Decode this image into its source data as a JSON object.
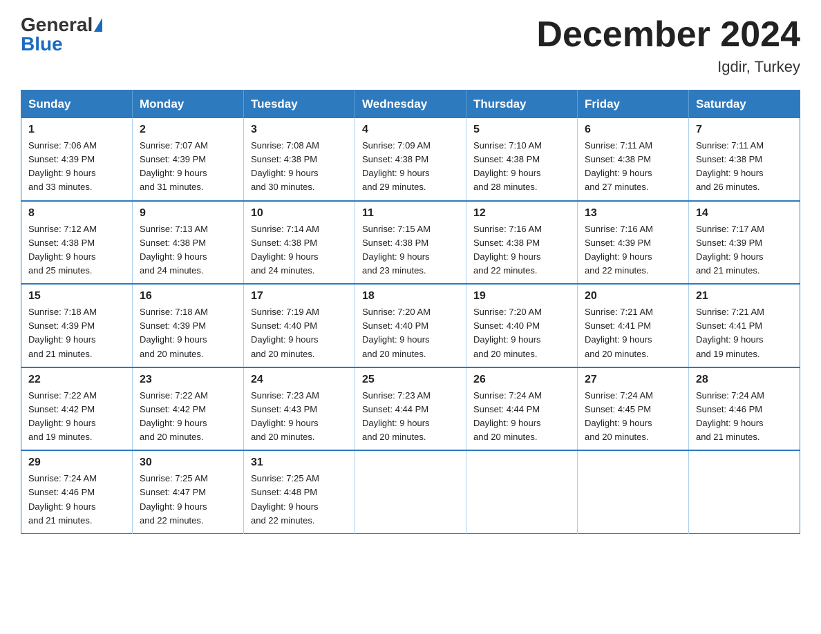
{
  "logo": {
    "general": "General",
    "blue": "Blue"
  },
  "title": "December 2024",
  "location": "Igdir, Turkey",
  "days_of_week": [
    "Sunday",
    "Monday",
    "Tuesday",
    "Wednesday",
    "Thursday",
    "Friday",
    "Saturday"
  ],
  "weeks": [
    [
      {
        "day": "1",
        "sunrise": "7:06 AM",
        "sunset": "4:39 PM",
        "daylight": "9 hours and 33 minutes."
      },
      {
        "day": "2",
        "sunrise": "7:07 AM",
        "sunset": "4:39 PM",
        "daylight": "9 hours and 31 minutes."
      },
      {
        "day": "3",
        "sunrise": "7:08 AM",
        "sunset": "4:38 PM",
        "daylight": "9 hours and 30 minutes."
      },
      {
        "day": "4",
        "sunrise": "7:09 AM",
        "sunset": "4:38 PM",
        "daylight": "9 hours and 29 minutes."
      },
      {
        "day": "5",
        "sunrise": "7:10 AM",
        "sunset": "4:38 PM",
        "daylight": "9 hours and 28 minutes."
      },
      {
        "day": "6",
        "sunrise": "7:11 AM",
        "sunset": "4:38 PM",
        "daylight": "9 hours and 27 minutes."
      },
      {
        "day": "7",
        "sunrise": "7:11 AM",
        "sunset": "4:38 PM",
        "daylight": "9 hours and 26 minutes."
      }
    ],
    [
      {
        "day": "8",
        "sunrise": "7:12 AM",
        "sunset": "4:38 PM",
        "daylight": "9 hours and 25 minutes."
      },
      {
        "day": "9",
        "sunrise": "7:13 AM",
        "sunset": "4:38 PM",
        "daylight": "9 hours and 24 minutes."
      },
      {
        "day": "10",
        "sunrise": "7:14 AM",
        "sunset": "4:38 PM",
        "daylight": "9 hours and 24 minutes."
      },
      {
        "day": "11",
        "sunrise": "7:15 AM",
        "sunset": "4:38 PM",
        "daylight": "9 hours and 23 minutes."
      },
      {
        "day": "12",
        "sunrise": "7:16 AM",
        "sunset": "4:38 PM",
        "daylight": "9 hours and 22 minutes."
      },
      {
        "day": "13",
        "sunrise": "7:16 AM",
        "sunset": "4:39 PM",
        "daylight": "9 hours and 22 minutes."
      },
      {
        "day": "14",
        "sunrise": "7:17 AM",
        "sunset": "4:39 PM",
        "daylight": "9 hours and 21 minutes."
      }
    ],
    [
      {
        "day": "15",
        "sunrise": "7:18 AM",
        "sunset": "4:39 PM",
        "daylight": "9 hours and 21 minutes."
      },
      {
        "day": "16",
        "sunrise": "7:18 AM",
        "sunset": "4:39 PM",
        "daylight": "9 hours and 20 minutes."
      },
      {
        "day": "17",
        "sunrise": "7:19 AM",
        "sunset": "4:40 PM",
        "daylight": "9 hours and 20 minutes."
      },
      {
        "day": "18",
        "sunrise": "7:20 AM",
        "sunset": "4:40 PM",
        "daylight": "9 hours and 20 minutes."
      },
      {
        "day": "19",
        "sunrise": "7:20 AM",
        "sunset": "4:40 PM",
        "daylight": "9 hours and 20 minutes."
      },
      {
        "day": "20",
        "sunrise": "7:21 AM",
        "sunset": "4:41 PM",
        "daylight": "9 hours and 20 minutes."
      },
      {
        "day": "21",
        "sunrise": "7:21 AM",
        "sunset": "4:41 PM",
        "daylight": "9 hours and 19 minutes."
      }
    ],
    [
      {
        "day": "22",
        "sunrise": "7:22 AM",
        "sunset": "4:42 PM",
        "daylight": "9 hours and 19 minutes."
      },
      {
        "day": "23",
        "sunrise": "7:22 AM",
        "sunset": "4:42 PM",
        "daylight": "9 hours and 20 minutes."
      },
      {
        "day": "24",
        "sunrise": "7:23 AM",
        "sunset": "4:43 PM",
        "daylight": "9 hours and 20 minutes."
      },
      {
        "day": "25",
        "sunrise": "7:23 AM",
        "sunset": "4:44 PM",
        "daylight": "9 hours and 20 minutes."
      },
      {
        "day": "26",
        "sunrise": "7:24 AM",
        "sunset": "4:44 PM",
        "daylight": "9 hours and 20 minutes."
      },
      {
        "day": "27",
        "sunrise": "7:24 AM",
        "sunset": "4:45 PM",
        "daylight": "9 hours and 20 minutes."
      },
      {
        "day": "28",
        "sunrise": "7:24 AM",
        "sunset": "4:46 PM",
        "daylight": "9 hours and 21 minutes."
      }
    ],
    [
      {
        "day": "29",
        "sunrise": "7:24 AM",
        "sunset": "4:46 PM",
        "daylight": "9 hours and 21 minutes."
      },
      {
        "day": "30",
        "sunrise": "7:25 AM",
        "sunset": "4:47 PM",
        "daylight": "9 hours and 22 minutes."
      },
      {
        "day": "31",
        "sunrise": "7:25 AM",
        "sunset": "4:48 PM",
        "daylight": "9 hours and 22 minutes."
      },
      null,
      null,
      null,
      null
    ]
  ],
  "labels": {
    "sunrise": "Sunrise:",
    "sunset": "Sunset:",
    "daylight": "Daylight:"
  }
}
